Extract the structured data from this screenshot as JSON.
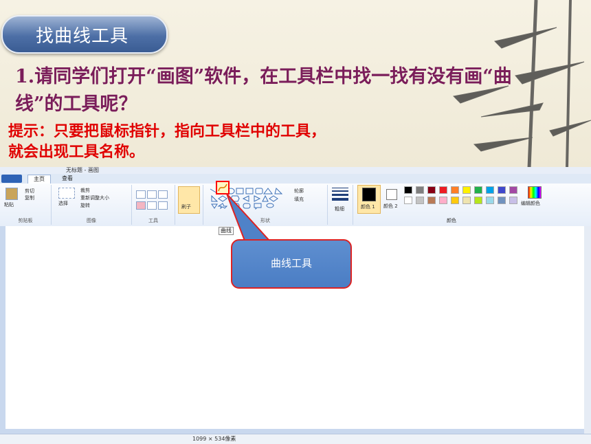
{
  "slide": {
    "title": "找曲线工具",
    "instruction_num": "1.",
    "instruction": "请同学们打开“画图”软件，在工具栏中找一找有没有画“曲线”的工具呢？",
    "hint_line1": "提示：只要把鼠标指针，指向工具栏中的工具，",
    "hint_line2": "就会出现工具名称。"
  },
  "paint": {
    "window_title": "无标题 - 画图",
    "tabs": [
      "主页",
      "查看"
    ],
    "clipboard": {
      "paste": "粘贴",
      "cut": "剪切",
      "copy": "复制",
      "label": "剪贴板"
    },
    "image": {
      "select": "选择",
      "crop": "裁剪",
      "resize": "重新调整大小",
      "rotate": "旋转",
      "label": "图像"
    },
    "tools": {
      "label": "工具",
      "brush": "刷子"
    },
    "shapes": {
      "outline": "轮廓",
      "fill": "填充",
      "label": "形状"
    },
    "size_label": "粗细",
    "color1": "颜色 1",
    "color2": "颜色 2",
    "colors_label": "颜色",
    "edit_colors": "编辑颜色",
    "tooltip": "曲线",
    "status_size": "1099 × 534像素",
    "palette": [
      "#000000",
      "#7f7f7f",
      "#880015",
      "#ed1c24",
      "#ff7f27",
      "#fff200",
      "#22b14c",
      "#00a2e8",
      "#3f48cc",
      "#a349a4",
      "#ffffff",
      "#c3c3c3",
      "#b97a57",
      "#ffaec9",
      "#ffc90e",
      "#efe4b0",
      "#b5e61d",
      "#99d9ea",
      "#7092be",
      "#c8bfe7"
    ]
  },
  "callout": {
    "text": "曲线工具"
  }
}
